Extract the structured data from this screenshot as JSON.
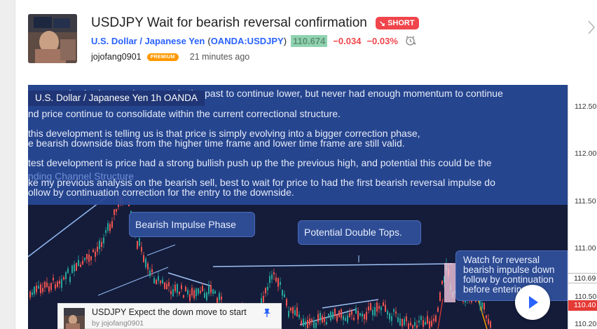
{
  "idea": {
    "title": "USDJPY Wait for bearish reversal confirmation",
    "badge": "SHORT",
    "symbol_name": "U.S. Dollar / Japanese Yen",
    "open_paren": "(",
    "ticker": "OANDA:USDJPY",
    "close_paren": ")",
    "price": "110.674",
    "change": "−0.034",
    "change_pct": "−0.03%",
    "author": "jojofang0901",
    "author_badge": "PREMIUM",
    "time": "21 minutes ago"
  },
  "colors": {
    "accent_blue": "#2962ff",
    "short_red": "#f0454b",
    "premium_orange": "#ff9800",
    "price_green": "#8fd3b0",
    "chart_bg": "#141c3a",
    "note_bg": "#284896"
  },
  "chart": {
    "legend": "U.S. Dollar / Japanese Yen  1h  OANDA",
    "note_lines": [
      "ne see price had several attempts in the past to continue lower, but never had enough momentum to continue",
      "nd price continue to consolidate within the current correctional structure.",
      "this development is telling us is that price is simply evolving into a bigger correction phase,",
      "e bearish downside bias from the higher time frame and lower time frame are still valid.",
      "test development is price had a strong bullish push up the the previous high, and potential this could be the",
      "nding Channel Structure",
      "ke my previous analysis on the bearish sell, best to wait for price to had the first bearish reversal impulse do",
      "ollow by continuation correction for the entry to the downside."
    ],
    "callouts": {
      "impulse": "Bearish Impulse Phase",
      "double_tops": "Potential Double Tops.",
      "watch": [
        "Watch for reversal",
        "bearish impulse down",
        "follow by continuation",
        "before entering"
      ]
    },
    "y_ticks": [
      "112.50",
      "112.00",
      "111.50",
      "111.00",
      "110.50",
      "110.20"
    ],
    "price_labels": [
      {
        "text": "110.69",
        "bg": "#ffffff",
        "fg": "#222222"
      },
      {
        "text": "110.40",
        "bg": "#e53935",
        "fg": "#ffffff"
      }
    ],
    "related": {
      "title": "USDJPY Expect the down move to start",
      "by": "by jojofang0901"
    }
  },
  "icons": [
    "arrow-down-right-icon",
    "alarm-clock-icon",
    "chevron-right-icon",
    "play-icon",
    "pin-icon"
  ]
}
